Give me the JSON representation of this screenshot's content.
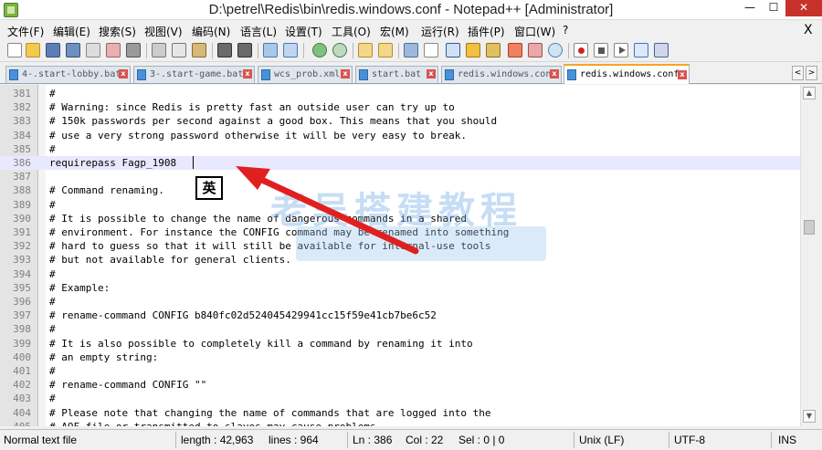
{
  "window": {
    "title": "D:\\petrel\\Redis\\bin\\redis.windows.conf - Notepad++ [Administrator]",
    "minimize_glyph": "—",
    "maximize_glyph": "☐",
    "close_glyph": "✕"
  },
  "menu": {
    "items": [
      "文件(F)",
      "编辑(E)",
      "搜索(S)",
      "视图(V)",
      "编码(N)",
      "语言(L)",
      "设置(T)",
      "工具(O)",
      "宏(M)",
      "运行(R)",
      "插件(P)",
      "窗口(W)",
      "?"
    ],
    "close_glyph": "X"
  },
  "toolbar": {
    "icons": [
      "new-file-icon",
      "open-file-icon",
      "save-icon",
      "save-all-icon",
      "close-icon",
      "close-all-icon",
      "print-icon",
      "cut-icon",
      "copy-icon",
      "paste-icon",
      "undo-icon",
      "redo-icon",
      "find-icon",
      "replace-icon",
      "zoom-in-icon",
      "zoom-out-icon",
      "sync-vertical-icon",
      "sync-horizontal-icon",
      "word-wrap-icon",
      "show-all-chars-icon",
      "indent-guide-icon",
      "user-language-icon",
      "doc-map-icon",
      "function-list-icon",
      "folder-workspace-icon",
      "monitor-icon",
      "record-macro-icon",
      "stop-macro-icon",
      "play-macro-icon",
      "play-multiple-icon",
      "save-macro-icon"
    ]
  },
  "tabs": [
    {
      "label": "4-.start-lobby.bat",
      "active": false
    },
    {
      "label": "3-.start-game.bat",
      "active": false
    },
    {
      "label": "wcs_prob.xml",
      "active": false
    },
    {
      "label": "start.bat",
      "active": false
    },
    {
      "label": "redis.windows.conf",
      "active": false
    },
    {
      "label": "redis.windows.conf",
      "active": true
    }
  ],
  "tab_scroll": {
    "left": "<",
    "right": ">"
  },
  "editor": {
    "lines": [
      {
        "num": "381",
        "text": "#"
      },
      {
        "num": "382",
        "text": "# Warning: since Redis is pretty fast an outside user can try up to"
      },
      {
        "num": "383",
        "text": "# 150k passwords per second against a good box. This means that you should"
      },
      {
        "num": "384",
        "text": "# use a very strong password otherwise it will be very easy to break."
      },
      {
        "num": "385",
        "text": "#"
      },
      {
        "num": "386",
        "text": "requirepass Fagp_1908",
        "current": true
      },
      {
        "num": "387",
        "text": ""
      },
      {
        "num": "388",
        "text": "# Command renaming."
      },
      {
        "num": "389",
        "text": "#"
      },
      {
        "num": "390",
        "text": "# It is possible to change the name of dangerous commands in a shared"
      },
      {
        "num": "391",
        "text": "# environment. For instance the CONFIG command may be renamed into something"
      },
      {
        "num": "392",
        "text": "# hard to guess so that it will still be available for internal-use tools"
      },
      {
        "num": "393",
        "text": "# but not available for general clients."
      },
      {
        "num": "394",
        "text": "#"
      },
      {
        "num": "395",
        "text": "# Example:"
      },
      {
        "num": "396",
        "text": "#"
      },
      {
        "num": "397",
        "text": "# rename-command CONFIG b840fc02d524045429941cc15f59e41cb7be6c52"
      },
      {
        "num": "398",
        "text": "#"
      },
      {
        "num": "399",
        "text": "# It is also possible to completely kill a command by renaming it into"
      },
      {
        "num": "400",
        "text": "# an empty string:"
      },
      {
        "num": "401",
        "text": "#"
      },
      {
        "num": "402",
        "text": "# rename-command CONFIG \"\""
      },
      {
        "num": "403",
        "text": "#"
      },
      {
        "num": "404",
        "text": "# Please note that changing the name of commands that are logged into the"
      },
      {
        "num": "405",
        "text": "# AOF file or transmitted to slaves may cause problems."
      }
    ]
  },
  "scrollbar": {
    "up": "▲",
    "down": "▼"
  },
  "overlay": {
    "ime_badge": "英",
    "watermark": "老吴搭建教程",
    "arrow_color": "#e02020"
  },
  "status": {
    "file_type": "Normal text file",
    "length": "length : 42,963",
    "lines": "lines : 964",
    "ln": "Ln : 386",
    "col": "Col : 22",
    "sel": "Sel : 0 | 0",
    "eol": "Unix (LF)",
    "encoding": "UTF-8",
    "mode": "INS"
  },
  "colors": {
    "current_line": "#e8e8ff",
    "close_button": "#c7312b",
    "active_tab_accent": "#f5a623"
  }
}
